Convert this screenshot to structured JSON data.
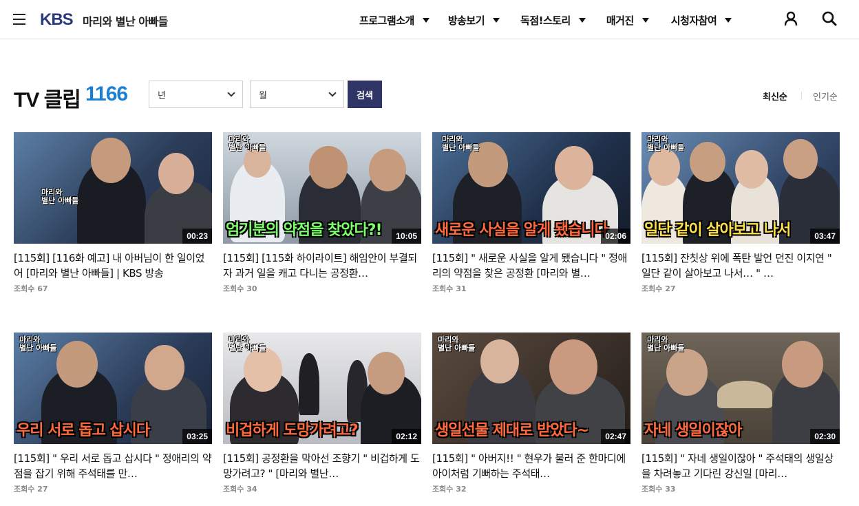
{
  "header": {
    "logo": "KBS",
    "program_title": "마리와 별난 아빠들",
    "nav": [
      {
        "label": "프로그램소개"
      },
      {
        "label": "방송보기"
      },
      {
        "label": "독점!스토리"
      },
      {
        "label": "매거진"
      },
      {
        "label": "시청자참여"
      }
    ]
  },
  "toolbar": {
    "title": "TV 클립",
    "count": "1166",
    "year_select": "년",
    "month_select": "월",
    "search_label": "검색",
    "sort_latest": "최신순",
    "sort_popular": "인기순"
  },
  "cards": [
    {
      "title": "[115회] [116화 예고] 내 아버님이 한 일이었어 [마리와 별난 아빠들] | KBS 방송",
      "views": "조회수 67",
      "duration": "00:23",
      "caption": ""
    },
    {
      "title": "[115회] [115화 하이라이트] 해임안이 부결되자 과거 일을 캐고 다니는 공정환…",
      "views": "조회수 30",
      "duration": "10:05",
      "caption": "엄기분의 약점을 찾았다?!"
    },
    {
      "title": "[115회] \" 새로운 사실을 알게 됐습니다 \" 정애리의 약점을 찾은 공정환 [마리와 별…",
      "views": "조회수 31",
      "duration": "02:06",
      "caption": "새로운 사실을 알게 됐습니다"
    },
    {
      "title": "[115회] 잔칫상 위에 폭탄 발언 던진 이지연 \" 일단 같이 살아보고 나서… \" …",
      "views": "조회수 27",
      "duration": "03:47",
      "caption": "일단 같이 살아보고 나서"
    },
    {
      "title": "[115회] \" 우리 서로 돕고 삽시다 \" 정애리의 약점을 잡기 위해 주석태를 만…",
      "views": "조회수 27",
      "duration": "03:25",
      "caption": "우리 서로 돕고 삽시다"
    },
    {
      "title": "[115회] 공정환을 막아선 조향기 \" 비겁하게 도망가려고? \" [마리와 별난…",
      "views": "조회수 34",
      "duration": "02:12",
      "caption": "비겁하게 도망가려고?"
    },
    {
      "title": "[115회] \" 아버지!! \" 현우가 불러 준 한마디에 아이처럼 기뻐하는 주석태…",
      "views": "조회수 32",
      "duration": "02:47",
      "caption": "생일선물 제대로 받았다~"
    },
    {
      "title": "[115회] \" 자네 생일이잖아 \" 주석태의 생일상을 차려놓고 기다린 강신일 [마리…",
      "views": "조회수 33",
      "duration": "02:30",
      "caption": "자네 생일이잖아"
    }
  ],
  "colors": {
    "accent": "#1a7fd4",
    "brand": "#2b3b7a",
    "button": "#2e3566"
  }
}
